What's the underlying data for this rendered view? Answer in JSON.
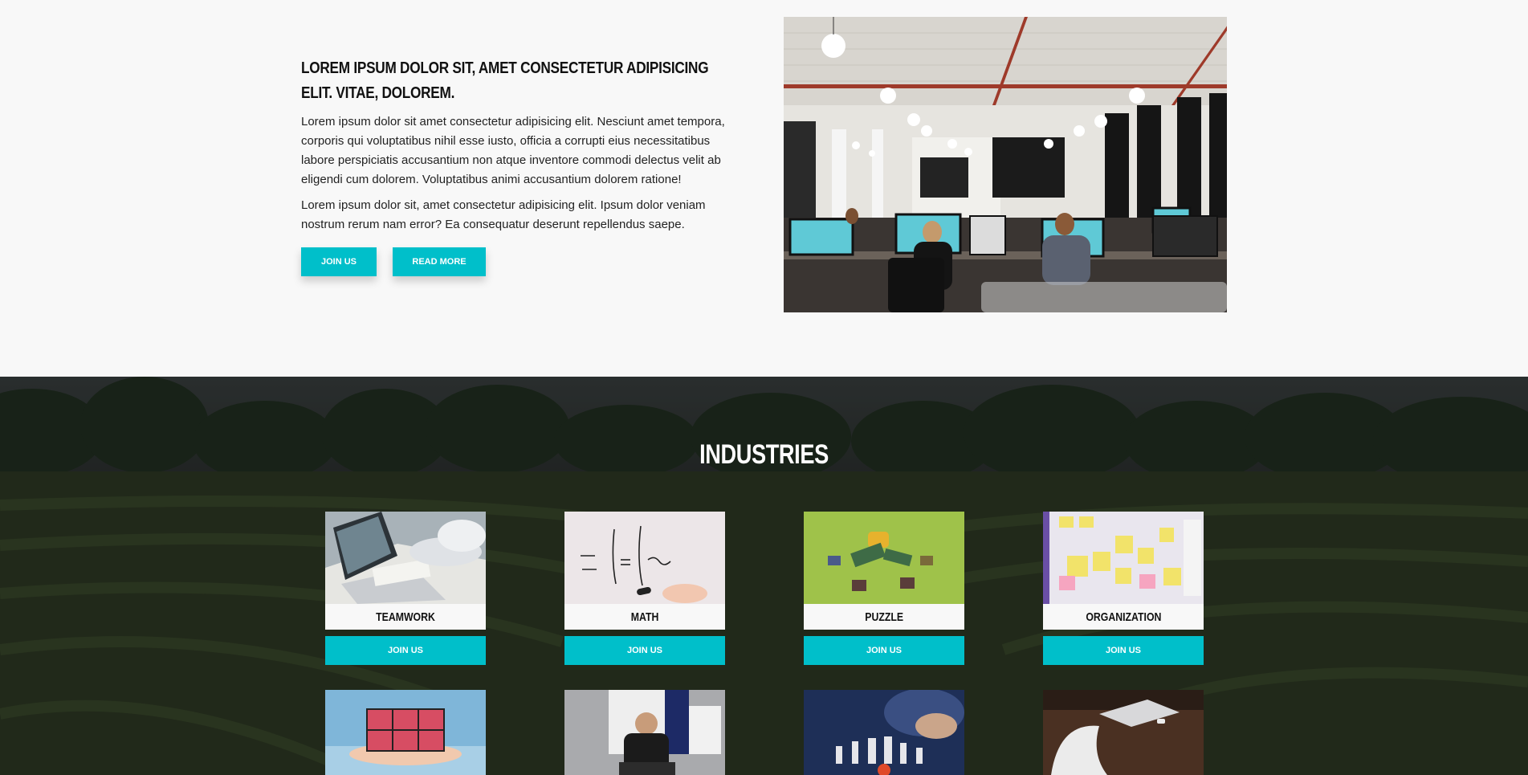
{
  "intro": {
    "heading": "Lorem ipsum dolor sit, amet consectetur adipisicing elit. Vitae, dolorem.",
    "paragraph1": "Lorem ipsum dolor sit amet consectetur adipisicing elit. Nesciunt amet tempora, corporis qui voluptatibus nihil esse iusto, officia a corrupti eius necessitatibus labore perspiciatis accusantium non atque inventore commodi delectus velit ab eligendi cum dolorem. Voluptatibus animi accusantium dolorem ratione!",
    "paragraph2": "Lorem ipsum dolor sit, amet consectetur adipisicing elit. Ipsum dolor veniam nostrum rerum nam error? Ea consequatur deserunt repellendus saepe.",
    "join_label": "JOIN US",
    "read_more_label": "READ MORE"
  },
  "industries": {
    "title": "INDUSTRIES",
    "cards": [
      {
        "label": "TEAMWORK",
        "button": "JOIN US"
      },
      {
        "label": "MATH",
        "button": "JOIN US"
      },
      {
        "label": "PUZZLE",
        "button": "JOIN US"
      },
      {
        "label": "ORGANIZATION",
        "button": "JOIN US"
      }
    ]
  },
  "colors": {
    "accent": "#00bfca",
    "page_bg": "#f8f8f8",
    "overlay": "#2b3027"
  }
}
